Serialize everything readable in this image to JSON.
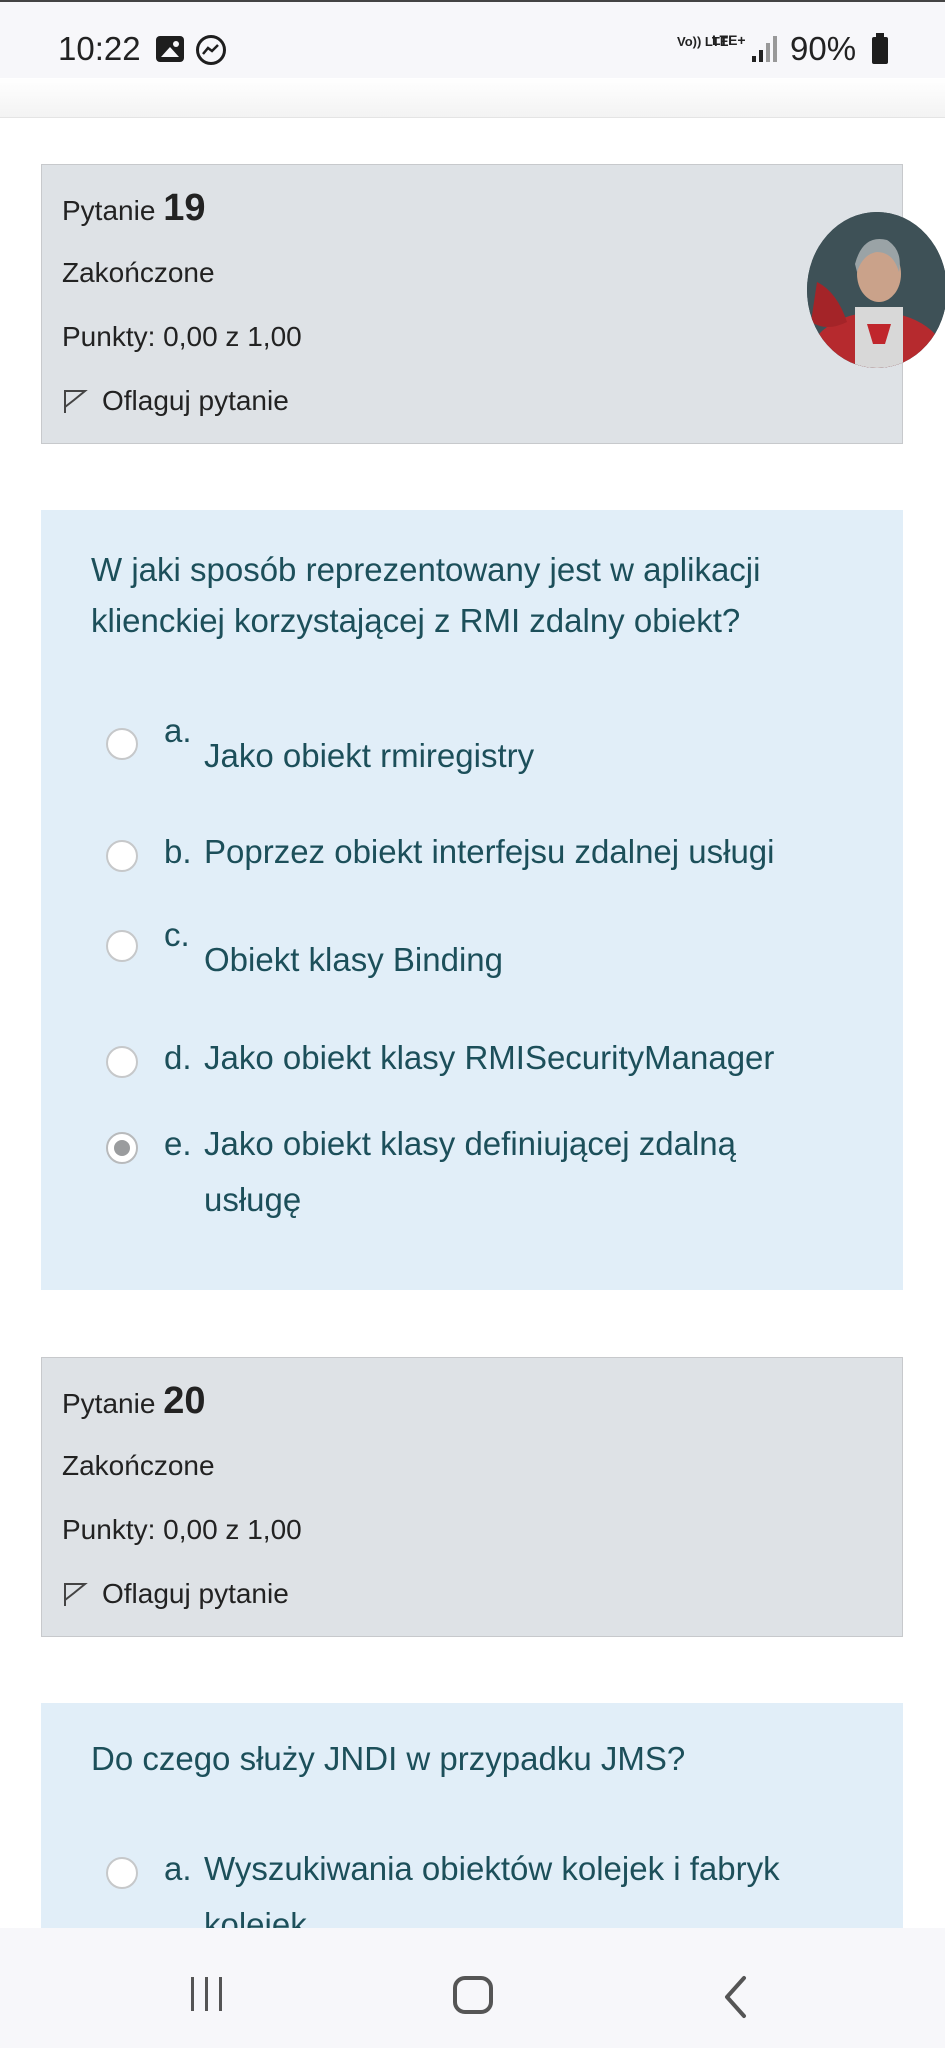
{
  "status_bar": {
    "time": "10:22",
    "volte_label": "Vo)) LTE",
    "network_label": "LTE+",
    "battery": "90%",
    "icons": [
      "gallery-icon",
      "messenger-icon",
      "signal-icon",
      "battery-icon"
    ]
  },
  "questions": [
    {
      "label": "Pytanie",
      "number": "19",
      "state": "Zakończone",
      "grade": "Punkty: 0,00 z 1,00",
      "flag_label": "Oflaguj pytanie",
      "text_lines": [
        "W jaki sposób reprezentowany jest w aplikacji",
        "klienckiej korzystającej z RMI zdalny obiekt?"
      ],
      "answers": [
        {
          "letter": "a.",
          "text": "Jako obiekt rmiregistry",
          "selected": false
        },
        {
          "letter": "b.",
          "text": "Poprzez obiekt interfejsu zdalnej usługi",
          "selected": false
        },
        {
          "letter": "c.",
          "text": "Obiekt klasy Binding",
          "selected": false
        },
        {
          "letter": "d.",
          "text": "Jako obiekt klasy RMISecurityManager",
          "selected": false
        },
        {
          "letter": "e.",
          "text_lines": [
            "Jako obiekt klasy definiującej zdalną",
            "usługę"
          ],
          "selected": true
        }
      ]
    },
    {
      "label": "Pytanie",
      "number": "20",
      "state": "Zakończone",
      "grade": "Punkty: 0,00 z 1,00",
      "flag_label": "Oflaguj pytanie",
      "text_lines": [
        "Do czego służy JNDI w przypadku JMS?"
      ],
      "answers": [
        {
          "letter": "a.",
          "text_lines": [
            "Wyszukiwania obiektów kolejek i fabryk",
            "kolejek"
          ],
          "selected": false
        }
      ]
    }
  ],
  "colors": {
    "info_bg": "#dee2e6",
    "content_bg": "#e1eef8",
    "question_text": "#1c4f5a"
  },
  "nav_bar": {
    "icons": [
      "recent-apps-icon",
      "home-icon",
      "back-icon"
    ]
  }
}
